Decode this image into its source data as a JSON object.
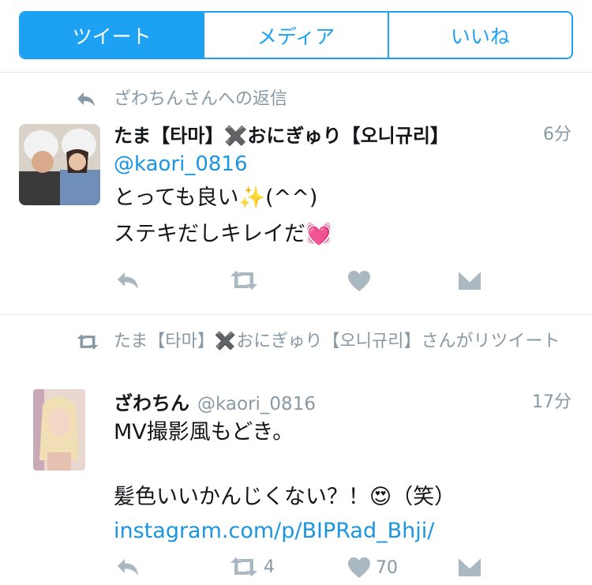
{
  "tabs": [
    {
      "label": "ツイート",
      "active": true
    },
    {
      "label": "メディア",
      "active": false
    },
    {
      "label": "いいね",
      "active": false
    }
  ],
  "tweets": [
    {
      "context": "ざわちんさんへの返信",
      "context_icon": "reply-icon",
      "author_name": "たま【타마】✖️おにぎゅり【오니규리】",
      "time": "6分",
      "mention": "@kaori_0816",
      "lines": [
        "とっても良い✨(^^)",
        "ステキだしキレイだ💓"
      ],
      "actions": {
        "reply": "",
        "retweet": "",
        "like": "",
        "dm": ""
      }
    },
    {
      "context": "たま【타마】✖️おにぎゅり【오니규리】さんがリツイート",
      "context_icon": "retweet-icon",
      "author_name": "ざわちん",
      "author_handle": "@kaori_0816",
      "time": "17分",
      "lines": [
        "MV撮影風もどき。",
        "",
        "髪色いいかんじくない？！😍（笑）"
      ],
      "link": "instagram.com/p/BIPRad_Bhji/",
      "actions": {
        "retweet_count": "4",
        "like_count": "70"
      }
    }
  ],
  "colors": {
    "accent": "#1da1f2",
    "link": "#1b95e0",
    "muted": "#8899a6",
    "icon": "#aab8c2"
  }
}
